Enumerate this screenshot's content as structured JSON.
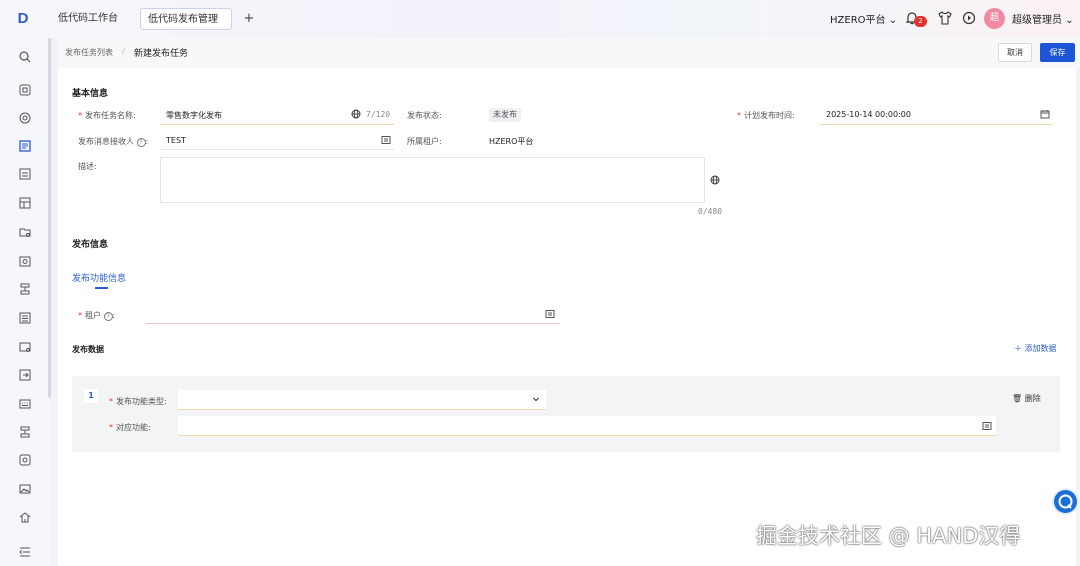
{
  "header": {
    "logo_glyph": "D",
    "tabs": [
      {
        "label": "低代码工作台"
      },
      {
        "label": "低代码发布管理"
      }
    ],
    "add_tab": "+",
    "tenant": "HZERO平台",
    "notification_count": "2",
    "user_avatar_text": "超",
    "user_name": "超级管理员"
  },
  "breadcrumb": {
    "parent": "发布任务列表",
    "separator": "/",
    "current": "新建发布任务"
  },
  "actions": {
    "cancel": "取消",
    "save": "保存"
  },
  "basic": {
    "title": "基本信息",
    "task_name_label": "发布任务名称:",
    "task_name_value": "零售数字化发布",
    "task_name_count": "7/120",
    "status_label": "发布状态:",
    "status_value": "未发布",
    "plan_time_label": "计划发布时间:",
    "plan_time_value": "2025-10-14 00:00:00",
    "receiver_label": "发布消息接收人",
    "receiver_value": "TEST",
    "tenant_label": "所属租户:",
    "tenant_value": "HZERO平台",
    "desc_label": "描述:",
    "desc_count": "0/480"
  },
  "publish": {
    "title": "发布信息",
    "tab_label": "发布功能信息",
    "tenant_label": "租户",
    "data_title": "发布数据",
    "add_label": "添加数据",
    "row_index": "1",
    "func_type_label": "发布功能类型:",
    "func_label": "对应功能:",
    "delete_label": "删除"
  },
  "watermark": "掘金技术社区 @ HAND汉得",
  "colors": {
    "accent": "#1d55d6",
    "required": "#e5322d",
    "badge": "#e5322d",
    "avatar": "#f08aa2"
  }
}
